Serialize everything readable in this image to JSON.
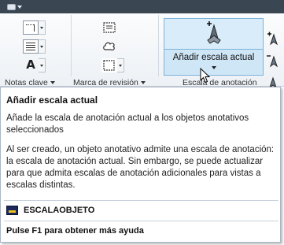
{
  "ribbon": {
    "panels": [
      {
        "label": "Notas clave"
      },
      {
        "label": "Marca de revisión"
      },
      {
        "label": "Escala de anotación"
      }
    ],
    "add_scale_button": {
      "label": "Añadir escala actual"
    }
  },
  "tooltip": {
    "title": "Añadir escala actual",
    "description": "Añade la escala de anotación actual a los objetos anotativos seleccionados",
    "extended": "Al ser creado, un objeto anotativo admite una escala de anotación: la escala de anotación actual. Sin embargo, se puede actualizar para que admita escalas de anotación adicionales para vistas a escalas distintas.",
    "command": "ESCALAOBJETO",
    "help": "Pulse F1 para obtener más ayuda"
  },
  "colors": {
    "titlebar": "#3a4652",
    "button_highlight": "#cfe6f7",
    "button_border": "#7db3da",
    "command_icon": "#1c2b5c"
  }
}
